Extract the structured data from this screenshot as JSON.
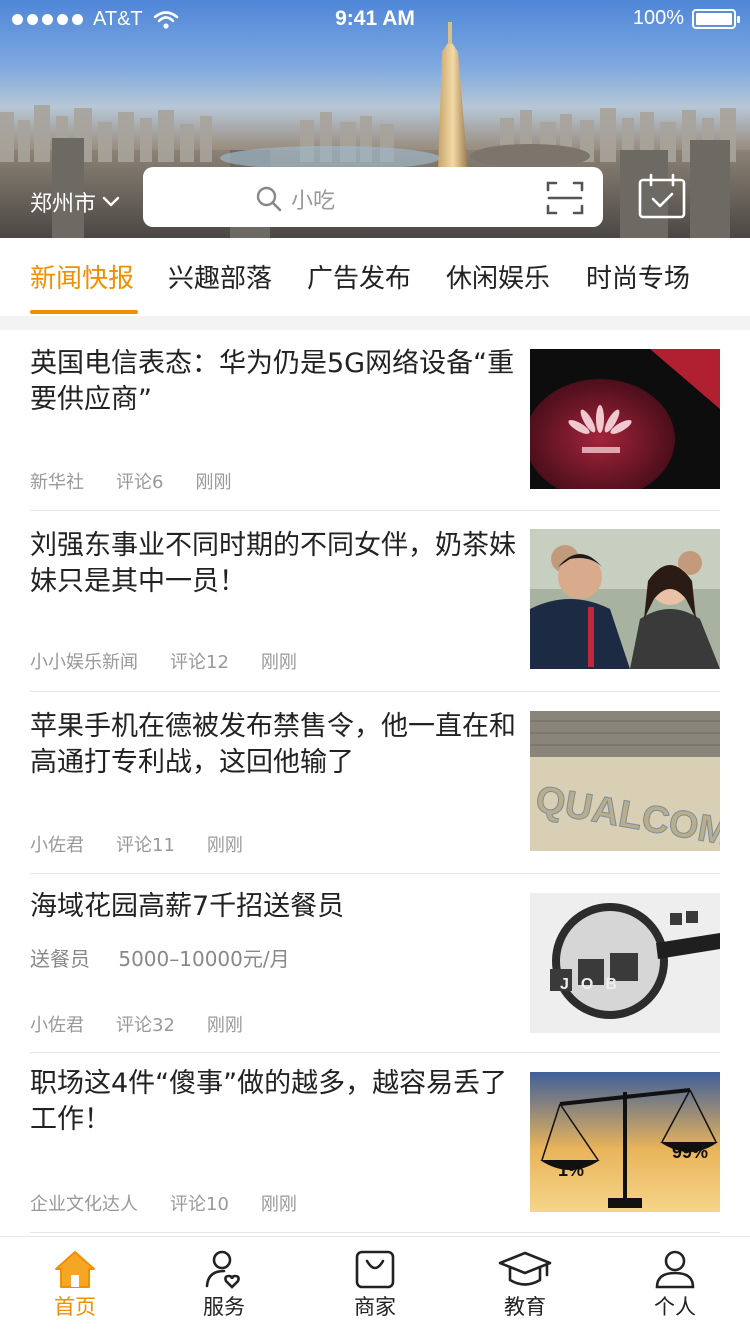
{
  "status_bar": {
    "carrier": "AT&T",
    "time": "9:41 AM",
    "battery": "100%"
  },
  "header": {
    "city": "郑州市",
    "search_placeholder": "小吃",
    "icons": [
      "search-icon",
      "scan-icon",
      "checkin-icon",
      "chevron-down-icon"
    ]
  },
  "tabs": [
    {
      "label": "新闻快报",
      "active": true
    },
    {
      "label": "兴趣部落",
      "active": false
    },
    {
      "label": "广告发布",
      "active": false
    },
    {
      "label": "休闲娱乐",
      "active": false
    },
    {
      "label": "时尚专场",
      "active": false
    }
  ],
  "accent_color": "#f18f00",
  "news": [
    {
      "title": "英国电信表态：华为仍是5G网络设备“重要供应商”",
      "source": "新华社",
      "comments": "评论6",
      "time": "刚刚",
      "image": "huawei-logo-image"
    },
    {
      "title": "刘强东事业不同时期的不同女伴，奶茶妹妹只是其中一员！",
      "source": "小小娱乐新闻",
      "comments": "评论12",
      "time": "刚刚",
      "image": "couple-photo-image"
    },
    {
      "title": "苹果手机在德被发布禁售令，他一直在和高通打专利战，这回他输了",
      "source": "小佐君",
      "comments": "评论11",
      "time": "刚刚",
      "image": "qualcomm-sign-image",
      "image_text": "QUALCOMM"
    },
    {
      "title": "海域花园高薪7千招送餐员",
      "subtitle_role": "送餐员",
      "subtitle_salary": "5000–10000元/月",
      "source": "小佐君",
      "comments": "评论32",
      "time": "刚刚",
      "image": "job-magnifier-image",
      "image_text": "JOB"
    },
    {
      "title": "职场这4件“傻事”做的越多，越容易丢了工作！",
      "source": "企业文化达人",
      "comments": "评论10",
      "time": "刚刚",
      "image": "balance-scale-image",
      "image_left": "1%",
      "image_right": "99%"
    }
  ],
  "bottom_nav": [
    {
      "label": "首页",
      "icon": "home-icon",
      "active": true
    },
    {
      "label": "服务",
      "icon": "service-icon",
      "active": false
    },
    {
      "label": "商家",
      "icon": "bag-icon",
      "active": false
    },
    {
      "label": "教育",
      "icon": "graduation-cap-icon",
      "active": false
    },
    {
      "label": "个人",
      "icon": "user-icon",
      "active": false
    }
  ]
}
